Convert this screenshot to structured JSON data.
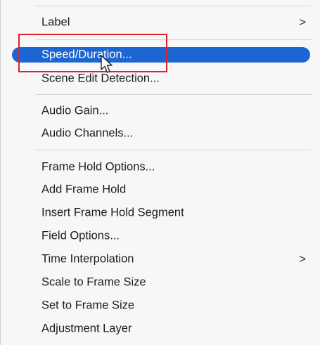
{
  "menu": {
    "items": [
      {
        "label": "Label",
        "submenu": true
      },
      {
        "label": "Speed/Duration...",
        "highlighted": true
      },
      {
        "label": "Scene Edit Detection..."
      },
      {
        "label": "Audio Gain..."
      },
      {
        "label": "Audio Channels..."
      },
      {
        "label": "Frame Hold Options..."
      },
      {
        "label": "Add Frame Hold"
      },
      {
        "label": "Insert Frame Hold Segment"
      },
      {
        "label": "Field Options..."
      },
      {
        "label": "Time Interpolation",
        "submenu": true
      },
      {
        "label": "Scale to Frame Size"
      },
      {
        "label": "Set to Frame Size"
      },
      {
        "label": "Adjustment Layer"
      }
    ],
    "submenu_glyph": ">",
    "highlight_color": "#1b66d2",
    "annotation_color": "#e0202a"
  },
  "cursor": {
    "icon": "pointer-cursor-icon"
  }
}
